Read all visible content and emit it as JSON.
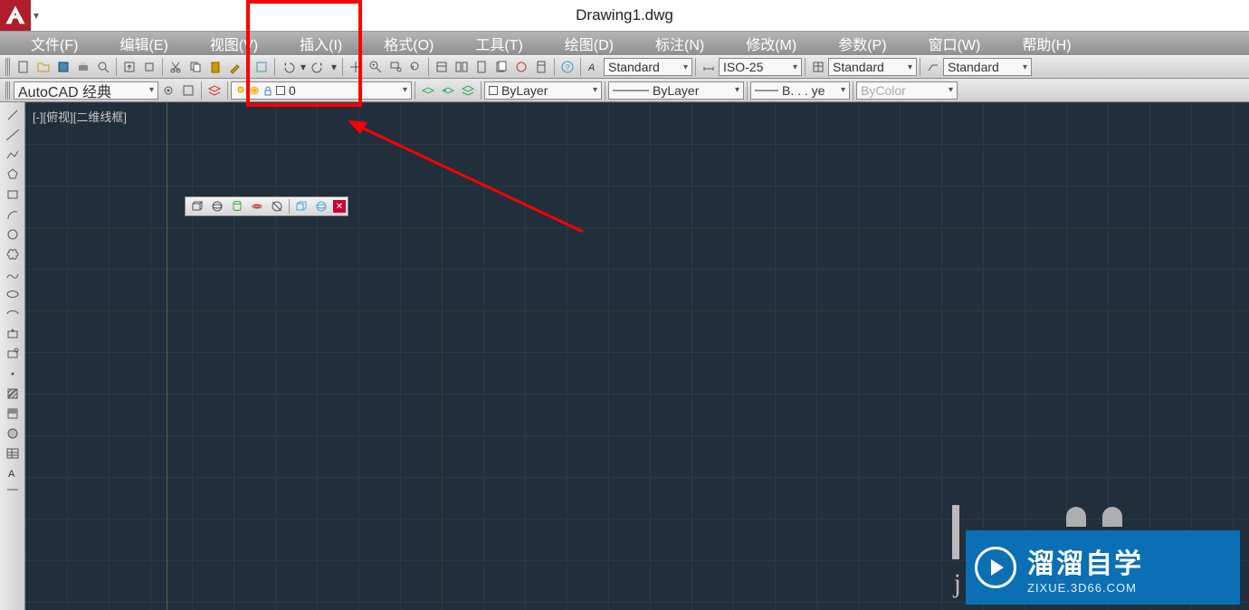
{
  "titlebar": {
    "title": "Drawing1.dwg"
  },
  "menu": {
    "file": "文件(F)",
    "edit": "编辑(E)",
    "view": "视图(V)",
    "insert": "插入(I)",
    "format": "格式(O)",
    "tools": "工具(T)",
    "draw": "绘图(D)",
    "dim": "标注(N)",
    "modify": "修改(M)",
    "param": "参数(P)",
    "window": "窗口(W)",
    "help": "帮助(H)"
  },
  "workspace": {
    "name": "AutoCAD 经典"
  },
  "layer": {
    "current": "0"
  },
  "linetype": {
    "label": "ByLayer"
  },
  "lineweight": {
    "label": "ByLayer"
  },
  "plotstyle": {
    "label": "B. . . ye"
  },
  "color": {
    "label": "ByColor"
  },
  "styles": {
    "textstyle": "Standard",
    "dimstyle": "ISO-25",
    "tablestyle": "Standard",
    "mlstyle": "Standard"
  },
  "viewport": {
    "label": "[-][俯视][二维线框]"
  },
  "watermark": {
    "big": "溜溜自学",
    "small": "ZIXUE.3D66.COM",
    "j": "j"
  }
}
